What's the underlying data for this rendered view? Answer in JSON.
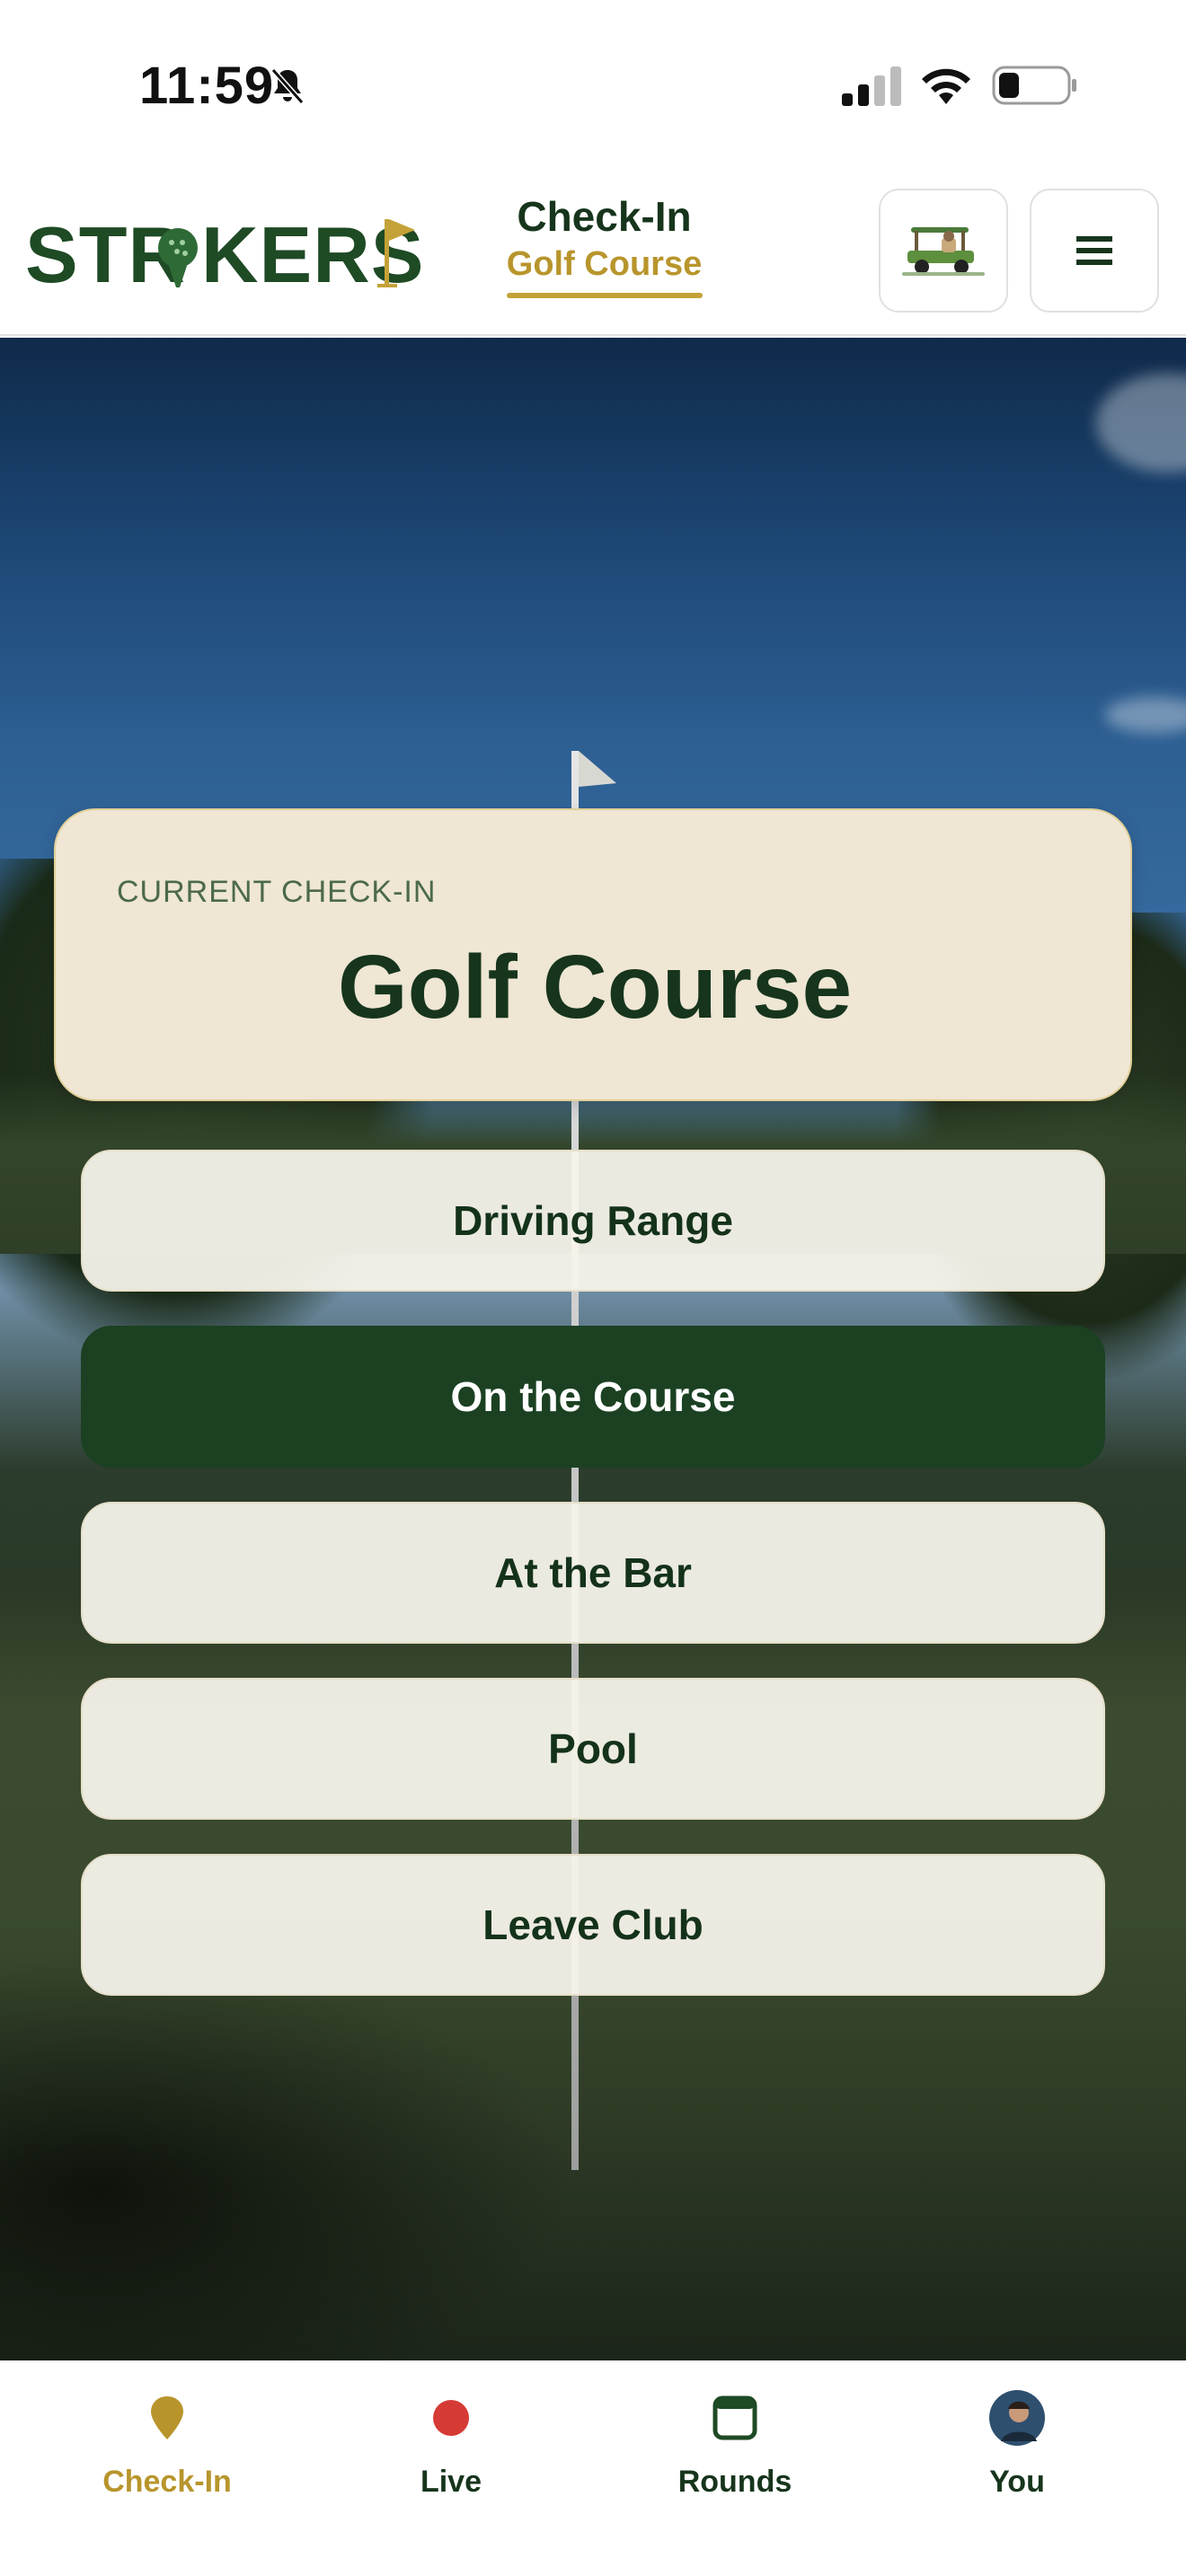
{
  "status": {
    "time": "11:59"
  },
  "header": {
    "logo_text": "STRIKERS",
    "title": "Check-In",
    "subtitle": "Golf Course"
  },
  "current": {
    "label": "CURRENT CHECK-IN",
    "value": "Golf Course"
  },
  "locations": [
    {
      "label": "Driving Range",
      "active": false
    },
    {
      "label": "On the Course",
      "active": true
    },
    {
      "label": "At the Bar",
      "active": false
    },
    {
      "label": "Pool",
      "active": false
    },
    {
      "label": "Leave Club",
      "active": false
    }
  ],
  "tabs": [
    {
      "label": "Check-In",
      "icon": "location-pin-icon",
      "active": true
    },
    {
      "label": "Live",
      "icon": "live-dot-icon",
      "active": false
    },
    {
      "label": "Rounds",
      "icon": "calendar-icon",
      "active": false
    },
    {
      "label": "You",
      "icon": "avatar",
      "active": false
    }
  ],
  "colors": {
    "brand_green": "#16351c",
    "accent_gold": "#b8952c",
    "card_cream": "#efe6d4",
    "live_red": "#d63a35"
  }
}
